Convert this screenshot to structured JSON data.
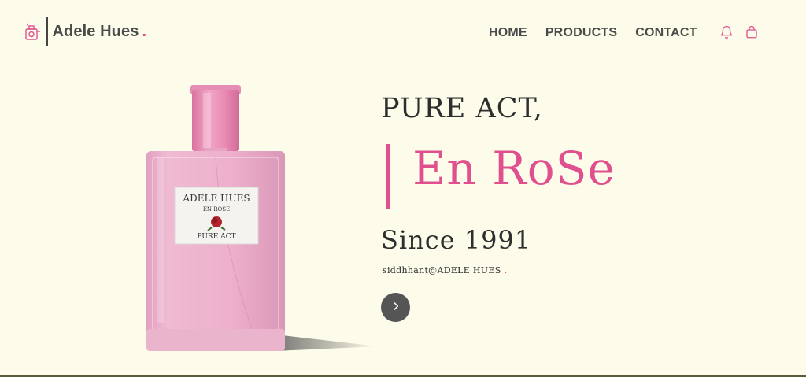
{
  "brand": {
    "name": "Adele Hues",
    "dot": ".",
    "accent": "#e0508f"
  },
  "nav": {
    "items": [
      {
        "label": "HOME"
      },
      {
        "label": "PRODUCTS"
      },
      {
        "label": "CONTACT"
      }
    ]
  },
  "header_icons": [
    "bell-icon",
    "shopping-bag-icon"
  ],
  "hero": {
    "line1": "PURE ACT,",
    "line2": "En RoSe",
    "line3": "Since 1991",
    "byline": "siddhhant@ADELE HUES",
    "byline_dot": "."
  },
  "bottle_label": {
    "title": "ADELE HUES",
    "subtitle": "EN ROSE",
    "footer": "PURE ACT"
  },
  "colors": {
    "background": "#fdfbe9",
    "text": "#2e2e2e",
    "pink": "#e0508f",
    "bottle": "#eca8c7",
    "button": "#555555"
  }
}
